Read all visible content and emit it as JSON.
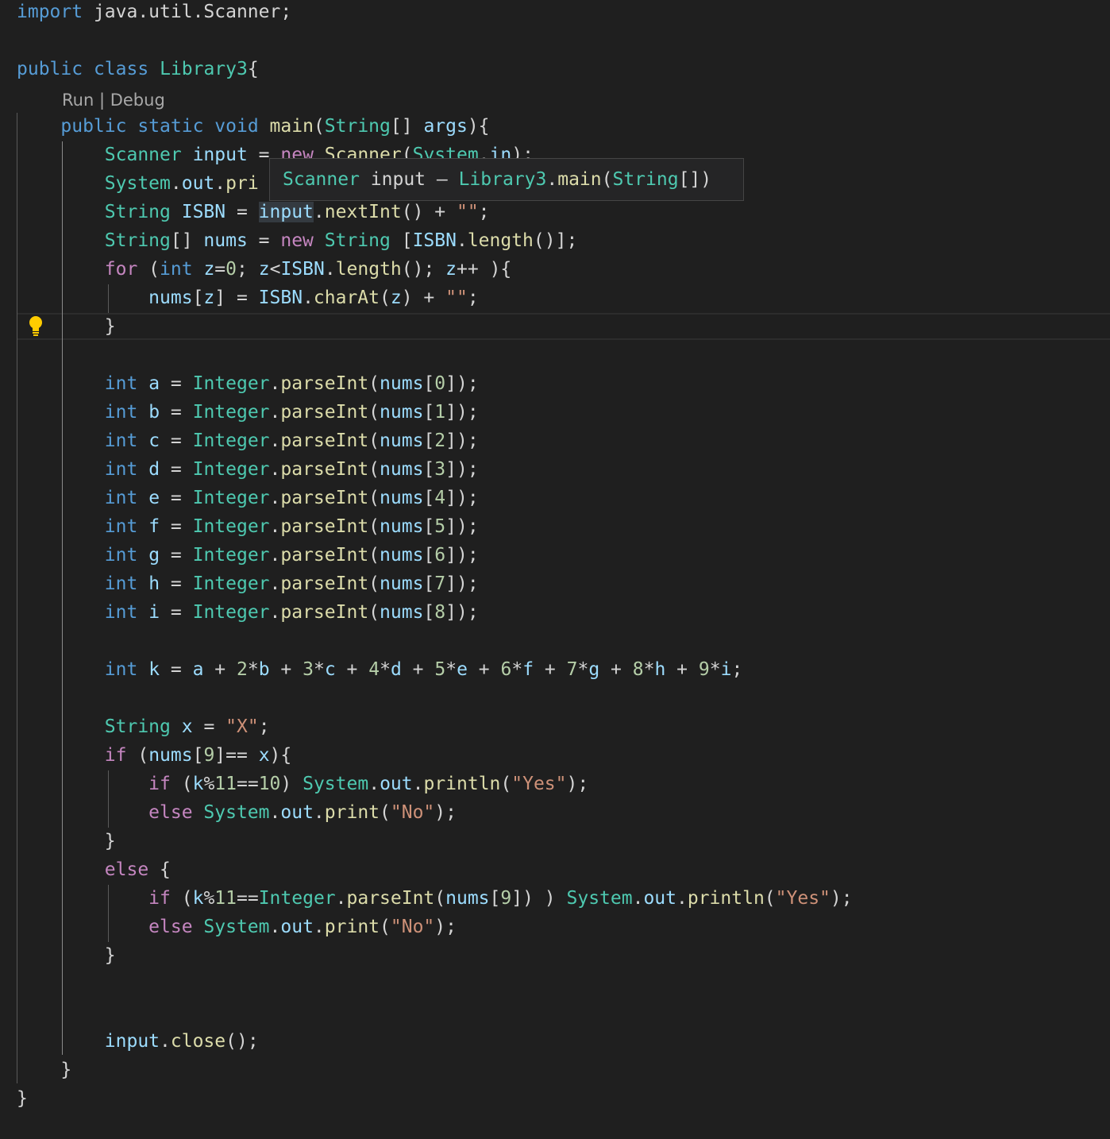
{
  "codelens": {
    "run": "Run",
    "sep": " | ",
    "debug": "Debug"
  },
  "hover": {
    "type": "Scanner",
    "name": " input",
    "dash": " – ",
    "cls": "Library3",
    "dot": ".",
    "method": "main",
    "open": "(",
    "param": "String",
    "close": "[])"
  },
  "colors": {
    "background": "#1f1f1f",
    "keyword": "#569cd6",
    "control": "#c586c0",
    "type": "#4ec9b0",
    "variable": "#9cdcfe",
    "function": "#dcdcaa",
    "string": "#ce9178",
    "number": "#b5cea8",
    "lightbulb": "#ffcc00"
  },
  "lines": [
    [
      [
        "kw",
        "import"
      ],
      [
        "pl",
        " java.util.Scanner;"
      ]
    ],
    [],
    [
      [
        "kw",
        "public"
      ],
      [
        "pl",
        " "
      ],
      [
        "kw",
        "class"
      ],
      [
        "pl",
        " "
      ],
      [
        "typ",
        "Library3"
      ],
      [
        "pl",
        "{"
      ]
    ],
    [],
    [
      [
        "pl",
        "    "
      ],
      [
        "kw",
        "public"
      ],
      [
        "pl",
        " "
      ],
      [
        "kw",
        "static"
      ],
      [
        "pl",
        " "
      ],
      [
        "kw",
        "void"
      ],
      [
        "pl",
        " "
      ],
      [
        "fn",
        "main"
      ],
      [
        "pl",
        "("
      ],
      [
        "typ",
        "String"
      ],
      [
        "pl",
        "[] "
      ],
      [
        "var",
        "args"
      ],
      [
        "pl",
        "){"
      ]
    ],
    [
      [
        "pl",
        "        "
      ],
      [
        "typ",
        "Scanner"
      ],
      [
        "pl",
        " "
      ],
      [
        "var",
        "input"
      ],
      [
        "pl",
        " = "
      ],
      [
        "ctl",
        "new"
      ],
      [
        "pl",
        " "
      ],
      [
        "fn",
        "Scanner"
      ],
      [
        "pl",
        "("
      ],
      [
        "typ",
        "System"
      ],
      [
        "pl",
        "."
      ],
      [
        "var",
        "in"
      ],
      [
        "pl",
        ");"
      ]
    ],
    [
      [
        "pl",
        "        "
      ],
      [
        "typ",
        "System"
      ],
      [
        "pl",
        "."
      ],
      [
        "var",
        "out"
      ],
      [
        "pl",
        "."
      ],
      [
        "fn",
        "pri"
      ]
    ],
    [
      [
        "pl",
        "        "
      ],
      [
        "typ",
        "String"
      ],
      [
        "pl",
        " "
      ],
      [
        "var",
        "ISBN"
      ],
      [
        "pl",
        " = "
      ],
      [
        "var",
        "input"
      ],
      [
        "pl",
        "."
      ],
      [
        "fn",
        "nextInt"
      ],
      [
        "pl",
        "() + "
      ],
      [
        "str",
        "\"\""
      ],
      [
        "pl",
        ";"
      ]
    ],
    [
      [
        "pl",
        "        "
      ],
      [
        "typ",
        "String"
      ],
      [
        "pl",
        "[] "
      ],
      [
        "var",
        "nums"
      ],
      [
        "pl",
        " = "
      ],
      [
        "ctl",
        "new"
      ],
      [
        "pl",
        " "
      ],
      [
        "typ",
        "String"
      ],
      [
        "pl",
        " ["
      ],
      [
        "var",
        "ISBN"
      ],
      [
        "pl",
        "."
      ],
      [
        "fn",
        "length"
      ],
      [
        "pl",
        "()];"
      ]
    ],
    [
      [
        "pl",
        "        "
      ],
      [
        "ctl",
        "for"
      ],
      [
        "pl",
        " ("
      ],
      [
        "kw",
        "int"
      ],
      [
        "pl",
        " "
      ],
      [
        "var",
        "z"
      ],
      [
        "pl",
        "="
      ],
      [
        "num",
        "0"
      ],
      [
        "pl",
        "; "
      ],
      [
        "var",
        "z"
      ],
      [
        "pl",
        "<"
      ],
      [
        "var",
        "ISBN"
      ],
      [
        "pl",
        "."
      ],
      [
        "fn",
        "length"
      ],
      [
        "pl",
        "(); "
      ],
      [
        "var",
        "z"
      ],
      [
        "pl",
        "++ ){"
      ]
    ],
    [
      [
        "pl",
        "            "
      ],
      [
        "var",
        "nums"
      ],
      [
        "pl",
        "["
      ],
      [
        "var",
        "z"
      ],
      [
        "pl",
        "] = "
      ],
      [
        "var",
        "ISBN"
      ],
      [
        "pl",
        "."
      ],
      [
        "fn",
        "charAt"
      ],
      [
        "pl",
        "("
      ],
      [
        "var",
        "z"
      ],
      [
        "pl",
        ") + "
      ],
      [
        "str",
        "\"\""
      ],
      [
        "pl",
        ";"
      ]
    ],
    [
      [
        "pl",
        "        }"
      ]
    ],
    [],
    [
      [
        "pl",
        "        "
      ],
      [
        "kw",
        "int"
      ],
      [
        "pl",
        " "
      ],
      [
        "var",
        "a"
      ],
      [
        "pl",
        " = "
      ],
      [
        "typ",
        "Integer"
      ],
      [
        "pl",
        "."
      ],
      [
        "fn",
        "parseInt"
      ],
      [
        "pl",
        "("
      ],
      [
        "var",
        "nums"
      ],
      [
        "pl",
        "["
      ],
      [
        "num",
        "0"
      ],
      [
        "pl",
        "]);"
      ]
    ],
    [
      [
        "pl",
        "        "
      ],
      [
        "kw",
        "int"
      ],
      [
        "pl",
        " "
      ],
      [
        "var",
        "b"
      ],
      [
        "pl",
        " = "
      ],
      [
        "typ",
        "Integer"
      ],
      [
        "pl",
        "."
      ],
      [
        "fn",
        "parseInt"
      ],
      [
        "pl",
        "("
      ],
      [
        "var",
        "nums"
      ],
      [
        "pl",
        "["
      ],
      [
        "num",
        "1"
      ],
      [
        "pl",
        "]);"
      ]
    ],
    [
      [
        "pl",
        "        "
      ],
      [
        "kw",
        "int"
      ],
      [
        "pl",
        " "
      ],
      [
        "var",
        "c"
      ],
      [
        "pl",
        " = "
      ],
      [
        "typ",
        "Integer"
      ],
      [
        "pl",
        "."
      ],
      [
        "fn",
        "parseInt"
      ],
      [
        "pl",
        "("
      ],
      [
        "var",
        "nums"
      ],
      [
        "pl",
        "["
      ],
      [
        "num",
        "2"
      ],
      [
        "pl",
        "]);"
      ]
    ],
    [
      [
        "pl",
        "        "
      ],
      [
        "kw",
        "int"
      ],
      [
        "pl",
        " "
      ],
      [
        "var",
        "d"
      ],
      [
        "pl",
        " = "
      ],
      [
        "typ",
        "Integer"
      ],
      [
        "pl",
        "."
      ],
      [
        "fn",
        "parseInt"
      ],
      [
        "pl",
        "("
      ],
      [
        "var",
        "nums"
      ],
      [
        "pl",
        "["
      ],
      [
        "num",
        "3"
      ],
      [
        "pl",
        "]);"
      ]
    ],
    [
      [
        "pl",
        "        "
      ],
      [
        "kw",
        "int"
      ],
      [
        "pl",
        " "
      ],
      [
        "var",
        "e"
      ],
      [
        "pl",
        " = "
      ],
      [
        "typ",
        "Integer"
      ],
      [
        "pl",
        "."
      ],
      [
        "fn",
        "parseInt"
      ],
      [
        "pl",
        "("
      ],
      [
        "var",
        "nums"
      ],
      [
        "pl",
        "["
      ],
      [
        "num",
        "4"
      ],
      [
        "pl",
        "]);"
      ]
    ],
    [
      [
        "pl",
        "        "
      ],
      [
        "kw",
        "int"
      ],
      [
        "pl",
        " "
      ],
      [
        "var",
        "f"
      ],
      [
        "pl",
        " = "
      ],
      [
        "typ",
        "Integer"
      ],
      [
        "pl",
        "."
      ],
      [
        "fn",
        "parseInt"
      ],
      [
        "pl",
        "("
      ],
      [
        "var",
        "nums"
      ],
      [
        "pl",
        "["
      ],
      [
        "num",
        "5"
      ],
      [
        "pl",
        "]);"
      ]
    ],
    [
      [
        "pl",
        "        "
      ],
      [
        "kw",
        "int"
      ],
      [
        "pl",
        " "
      ],
      [
        "var",
        "g"
      ],
      [
        "pl",
        " = "
      ],
      [
        "typ",
        "Integer"
      ],
      [
        "pl",
        "."
      ],
      [
        "fn",
        "parseInt"
      ],
      [
        "pl",
        "("
      ],
      [
        "var",
        "nums"
      ],
      [
        "pl",
        "["
      ],
      [
        "num",
        "6"
      ],
      [
        "pl",
        "]);"
      ]
    ],
    [
      [
        "pl",
        "        "
      ],
      [
        "kw",
        "int"
      ],
      [
        "pl",
        " "
      ],
      [
        "var",
        "h"
      ],
      [
        "pl",
        " = "
      ],
      [
        "typ",
        "Integer"
      ],
      [
        "pl",
        "."
      ],
      [
        "fn",
        "parseInt"
      ],
      [
        "pl",
        "("
      ],
      [
        "var",
        "nums"
      ],
      [
        "pl",
        "["
      ],
      [
        "num",
        "7"
      ],
      [
        "pl",
        "]);"
      ]
    ],
    [
      [
        "pl",
        "        "
      ],
      [
        "kw",
        "int"
      ],
      [
        "pl",
        " "
      ],
      [
        "var",
        "i"
      ],
      [
        "pl",
        " = "
      ],
      [
        "typ",
        "Integer"
      ],
      [
        "pl",
        "."
      ],
      [
        "fn",
        "parseInt"
      ],
      [
        "pl",
        "("
      ],
      [
        "var",
        "nums"
      ],
      [
        "pl",
        "["
      ],
      [
        "num",
        "8"
      ],
      [
        "pl",
        "]);"
      ]
    ],
    [],
    [
      [
        "pl",
        "        "
      ],
      [
        "kw",
        "int"
      ],
      [
        "pl",
        " "
      ],
      [
        "var",
        "k"
      ],
      [
        "pl",
        " = "
      ],
      [
        "var",
        "a"
      ],
      [
        "pl",
        " + "
      ],
      [
        "num",
        "2"
      ],
      [
        "pl",
        "*"
      ],
      [
        "var",
        "b"
      ],
      [
        "pl",
        " + "
      ],
      [
        "num",
        "3"
      ],
      [
        "pl",
        "*"
      ],
      [
        "var",
        "c"
      ],
      [
        "pl",
        " + "
      ],
      [
        "num",
        "4"
      ],
      [
        "pl",
        "*"
      ],
      [
        "var",
        "d"
      ],
      [
        "pl",
        " + "
      ],
      [
        "num",
        "5"
      ],
      [
        "pl",
        "*"
      ],
      [
        "var",
        "e"
      ],
      [
        "pl",
        " + "
      ],
      [
        "num",
        "6"
      ],
      [
        "pl",
        "*"
      ],
      [
        "var",
        "f"
      ],
      [
        "pl",
        " + "
      ],
      [
        "num",
        "7"
      ],
      [
        "pl",
        "*"
      ],
      [
        "var",
        "g"
      ],
      [
        "pl",
        " + "
      ],
      [
        "num",
        "8"
      ],
      [
        "pl",
        "*"
      ],
      [
        "var",
        "h"
      ],
      [
        "pl",
        " + "
      ],
      [
        "num",
        "9"
      ],
      [
        "pl",
        "*"
      ],
      [
        "var",
        "i"
      ],
      [
        "pl",
        ";"
      ]
    ],
    [],
    [
      [
        "pl",
        "        "
      ],
      [
        "typ",
        "String"
      ],
      [
        "pl",
        " "
      ],
      [
        "var",
        "x"
      ],
      [
        "pl",
        " = "
      ],
      [
        "str",
        "\"X\""
      ],
      [
        "pl",
        ";"
      ]
    ],
    [
      [
        "pl",
        "        "
      ],
      [
        "ctl",
        "if"
      ],
      [
        "pl",
        " ("
      ],
      [
        "var",
        "nums"
      ],
      [
        "pl",
        "["
      ],
      [
        "num",
        "9"
      ],
      [
        "pl",
        "]== "
      ],
      [
        "var",
        "x"
      ],
      [
        "pl",
        "){"
      ]
    ],
    [
      [
        "pl",
        "            "
      ],
      [
        "ctl",
        "if"
      ],
      [
        "pl",
        " ("
      ],
      [
        "var",
        "k"
      ],
      [
        "pl",
        "%"
      ],
      [
        "num",
        "11"
      ],
      [
        "pl",
        "=="
      ],
      [
        "num",
        "10"
      ],
      [
        "pl",
        ") "
      ],
      [
        "typ",
        "System"
      ],
      [
        "pl",
        "."
      ],
      [
        "var",
        "out"
      ],
      [
        "pl",
        "."
      ],
      [
        "fn",
        "println"
      ],
      [
        "pl",
        "("
      ],
      [
        "str",
        "\"Yes\""
      ],
      [
        "pl",
        ");"
      ]
    ],
    [
      [
        "pl",
        "            "
      ],
      [
        "ctl",
        "else"
      ],
      [
        "pl",
        " "
      ],
      [
        "typ",
        "System"
      ],
      [
        "pl",
        "."
      ],
      [
        "var",
        "out"
      ],
      [
        "pl",
        "."
      ],
      [
        "fn",
        "print"
      ],
      [
        "pl",
        "("
      ],
      [
        "str",
        "\"No\""
      ],
      [
        "pl",
        ");"
      ]
    ],
    [
      [
        "pl",
        "        }"
      ]
    ],
    [
      [
        "pl",
        "        "
      ],
      [
        "ctl",
        "else"
      ],
      [
        "pl",
        " {"
      ]
    ],
    [
      [
        "pl",
        "            "
      ],
      [
        "ctl",
        "if"
      ],
      [
        "pl",
        " ("
      ],
      [
        "var",
        "k"
      ],
      [
        "pl",
        "%"
      ],
      [
        "num",
        "11"
      ],
      [
        "pl",
        "=="
      ],
      [
        "typ",
        "Integer"
      ],
      [
        "pl",
        "."
      ],
      [
        "fn",
        "parseInt"
      ],
      [
        "pl",
        "("
      ],
      [
        "var",
        "nums"
      ],
      [
        "pl",
        "["
      ],
      [
        "num",
        "9"
      ],
      [
        "pl",
        "]) ) "
      ],
      [
        "typ",
        "System"
      ],
      [
        "pl",
        "."
      ],
      [
        "var",
        "out"
      ],
      [
        "pl",
        "."
      ],
      [
        "fn",
        "println"
      ],
      [
        "pl",
        "("
      ],
      [
        "str",
        "\"Yes\""
      ],
      [
        "pl",
        ");"
      ]
    ],
    [
      [
        "pl",
        "            "
      ],
      [
        "ctl",
        "else"
      ],
      [
        "pl",
        " "
      ],
      [
        "typ",
        "System"
      ],
      [
        "pl",
        "."
      ],
      [
        "var",
        "out"
      ],
      [
        "pl",
        "."
      ],
      [
        "fn",
        "print"
      ],
      [
        "pl",
        "("
      ],
      [
        "str",
        "\"No\""
      ],
      [
        "pl",
        ");"
      ]
    ],
    [
      [
        "pl",
        "        }"
      ]
    ],
    [],
    [],
    [
      [
        "pl",
        "        "
      ],
      [
        "var",
        "input"
      ],
      [
        "pl",
        "."
      ],
      [
        "fn",
        "close"
      ],
      [
        "pl",
        "();"
      ]
    ],
    [
      [
        "pl",
        "    }"
      ]
    ],
    [
      [
        "pl",
        "}"
      ]
    ]
  ]
}
